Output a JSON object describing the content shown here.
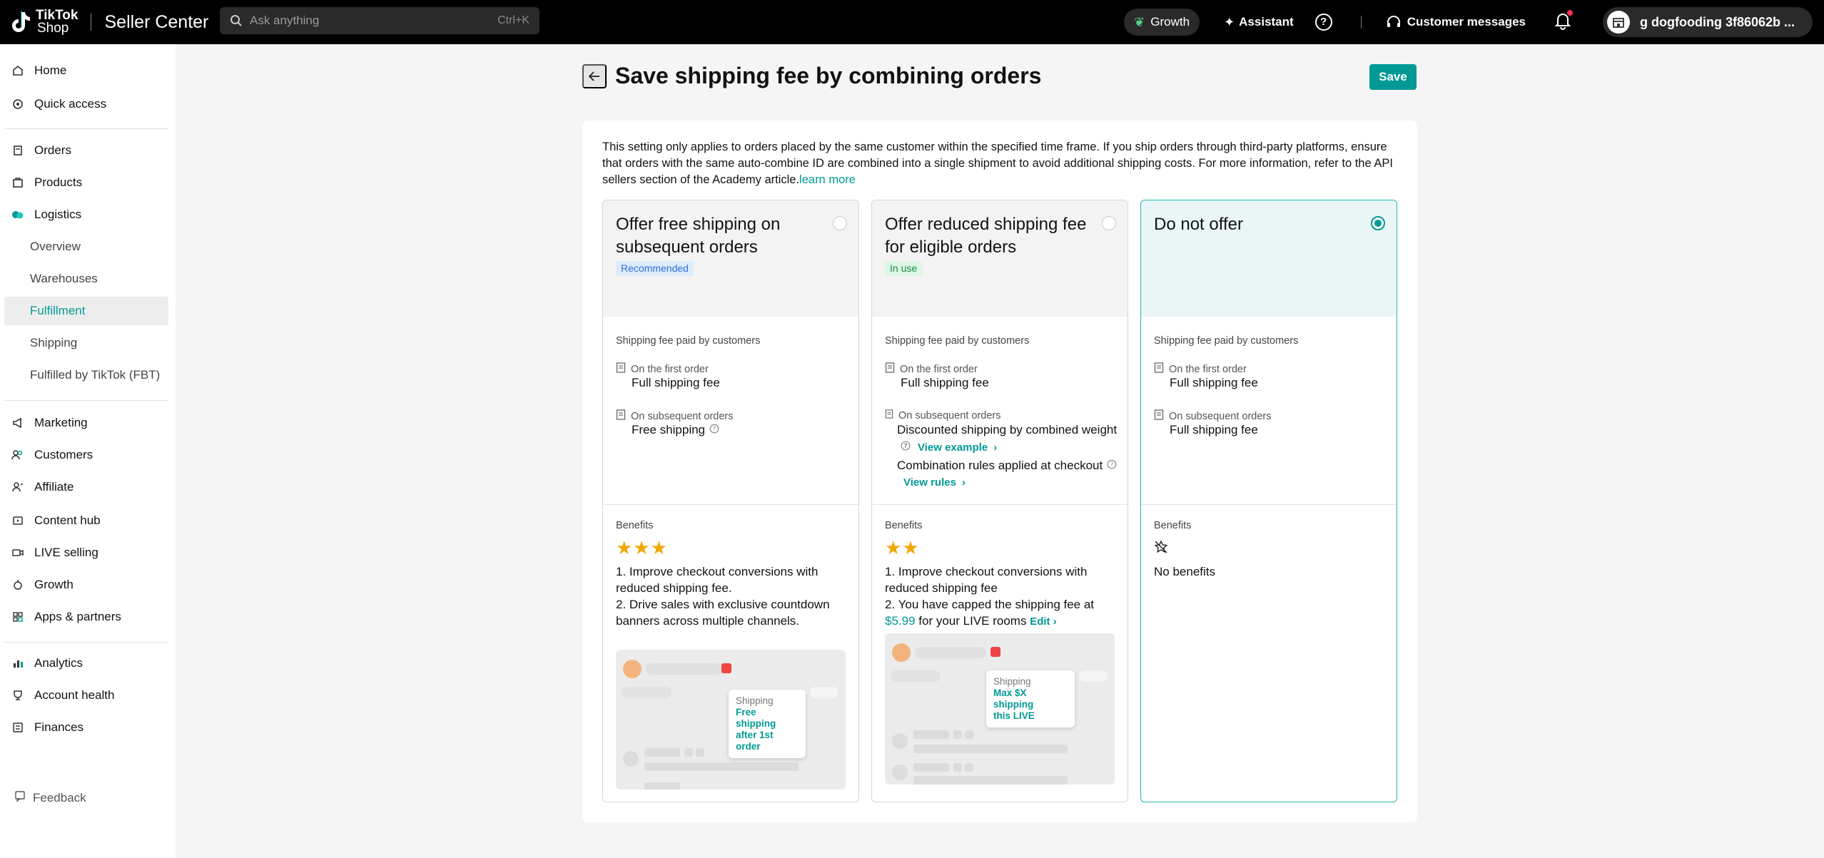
{
  "topbar": {
    "logo_line1": "TikTok",
    "logo_line2": "Shop",
    "app_title": "Seller Center",
    "search_placeholder": "Ask anything",
    "search_shortcut": "Ctrl+K",
    "growth_label": "Growth",
    "assistant_label": "Assistant",
    "customer_messages_label": "Customer messages",
    "account_name": "g dogfooding 3f86062b ..."
  },
  "sidebar": {
    "items": [
      {
        "label": "Home",
        "icon": "home-icon"
      },
      {
        "label": "Quick access",
        "icon": "quick-access-icon"
      },
      {
        "label": "Orders",
        "icon": "orders-icon"
      },
      {
        "label": "Products",
        "icon": "products-icon"
      },
      {
        "label": "Logistics",
        "icon": "logistics-icon"
      },
      {
        "label": "Marketing",
        "icon": "marketing-icon"
      },
      {
        "label": "Customers",
        "icon": "customers-icon"
      },
      {
        "label": "Affiliate",
        "icon": "affiliate-icon"
      },
      {
        "label": "Content hub",
        "icon": "content-hub-icon"
      },
      {
        "label": "LIVE selling",
        "icon": "live-selling-icon"
      },
      {
        "label": "Growth",
        "icon": "growth-icon"
      },
      {
        "label": "Apps & partners",
        "icon": "apps-icon"
      },
      {
        "label": "Analytics",
        "icon": "analytics-icon"
      },
      {
        "label": "Account health",
        "icon": "account-health-icon"
      },
      {
        "label": "Finances",
        "icon": "finances-icon"
      }
    ],
    "logistics_sub": [
      {
        "label": "Overview"
      },
      {
        "label": "Warehouses"
      },
      {
        "label": "Fulfillment",
        "active": true
      },
      {
        "label": "Shipping"
      },
      {
        "label": "Fulfilled by TikTok (FBT)"
      }
    ],
    "feedback_label": "Feedback"
  },
  "page": {
    "title": "Save shipping fee by combining orders",
    "save_label": "Save",
    "description": "This setting only applies to orders placed by the same customer within the specified time frame. If you ship orders through third-party platforms, ensure that orders with the same auto-combine ID are combined into a single shipment to avoid additional shipping costs. For more information, refer to the API sellers section of the Academy article.",
    "learn_more": "learn more"
  },
  "cards": [
    {
      "title": "Offer free shipping on subsequent orders",
      "badge": "Recommended",
      "selected": false,
      "fee_label": "Shipping fee paid by customers",
      "first_label": "On the first order",
      "first_value": "Full shipping fee",
      "subsequent_label": "On subsequent orders",
      "subsequent_value": "Free shipping",
      "benefits_label": "Benefits",
      "stars": 3,
      "benefit_1": "1. Improve checkout conversions with reduced shipping fee.",
      "benefit_2": "2. Drive sales with exclusive countdown banners across multiple channels.",
      "tip_title": "Shipping",
      "tip_line1": "Free shipping",
      "tip_line2": "after 1st order"
    },
    {
      "title": "Offer reduced shipping fee for eligible orders",
      "badge": "In use",
      "selected": false,
      "fee_label": "Shipping fee paid by customers",
      "first_label": "On the first order",
      "first_value": "Full shipping fee",
      "subsequent_label": "On subsequent orders",
      "subsequent_value_1": "Discounted shipping by combined weight",
      "view_example": "View example",
      "subsequent_value_2": "Combination rules applied at checkout",
      "view_rules": "View rules",
      "benefits_label": "Benefits",
      "stars": 2,
      "benefit_1": "1. Improve checkout conversions with reduced shipping fee",
      "benefit_2_pre": "2. You have capped the shipping fee at",
      "benefit_2_amount": "$5.99",
      "benefit_2_post": "for your LIVE rooms",
      "edit_label": "Edit",
      "tip_title": "Shipping",
      "tip_line1": "Max $X shipping",
      "tip_line2": "this LIVE"
    },
    {
      "title": "Do not offer",
      "selected": true,
      "fee_label": "Shipping fee paid by customers",
      "first_label": "On the first order",
      "first_value": "Full shipping fee",
      "subsequent_label": "On subsequent orders",
      "subsequent_value": "Full shipping fee",
      "benefits_label": "Benefits",
      "no_benefits": "No benefits"
    }
  ],
  "colors": {
    "accent": "#009995",
    "star": "#f0a800",
    "recommended_bg": "#ddebfc",
    "in_use_bg": "#dcf5e4"
  }
}
